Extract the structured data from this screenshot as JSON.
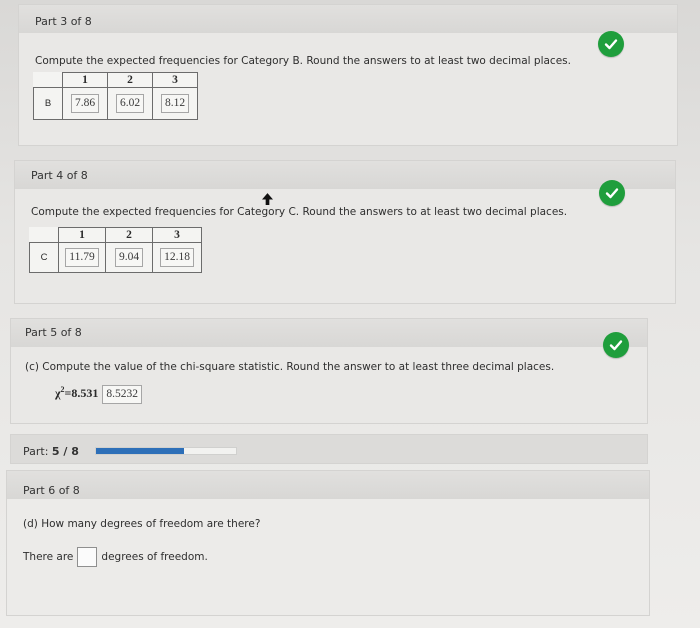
{
  "part3": {
    "title": "Part 3 of 8",
    "instruction": "Compute the expected frequencies for Category B. Round the answers to at least two decimal places.",
    "columns": [
      "1",
      "2",
      "3"
    ],
    "row_label": "B",
    "answers": [
      "7.86",
      "6.02",
      "8.12"
    ]
  },
  "part4": {
    "title": "Part 4 of 8",
    "instruction": "Compute the expected frequencies for Category C. Round the answers to at least two decimal places.",
    "columns": [
      "1",
      "2",
      "3"
    ],
    "row_label": "C",
    "answers": [
      "11.79",
      "9.04",
      "12.18"
    ]
  },
  "part5": {
    "title": "Part 5 of 8",
    "instruction": "(c) Compute the value of the chi-square statistic. Round the answer to at least three decimal places.",
    "chi_symbol": "χ",
    "chi_exp": "2",
    "chi_eq": "=",
    "chi_value": "8.531",
    "chi_answer": "8.5232"
  },
  "progress": {
    "label": "Part:",
    "current": "5",
    "separator": " / ",
    "total": "8",
    "fraction": 0.625,
    "fill_color": "#2d6fb8"
  },
  "part6": {
    "title": "Part 6 of 8",
    "instruction": "(d) How many degrees of freedom are there?",
    "prefix": "There are",
    "suffix": "degrees of freedom.",
    "answer": ""
  },
  "icons": {
    "check": "check-circle-icon",
    "check_color": "#1f9e3c"
  }
}
